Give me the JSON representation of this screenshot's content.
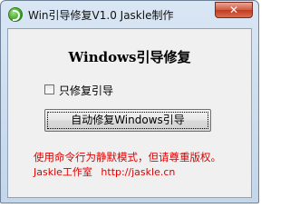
{
  "window": {
    "title": "Win引导修复V1.0   Jaskle制作",
    "close_label": "✕"
  },
  "main": {
    "heading": "Windows引导修复",
    "checkbox": {
      "label": "只修复引导",
      "checked": false
    },
    "fix_button_label": "自动修复Windows引导",
    "warning_text": "使用命令行为静默模式，但请尊重版权。",
    "footer": {
      "studio": "Jaskle工作室",
      "url": "http://jaskle.cn"
    }
  },
  "colors": {
    "warning": "#e00000"
  }
}
